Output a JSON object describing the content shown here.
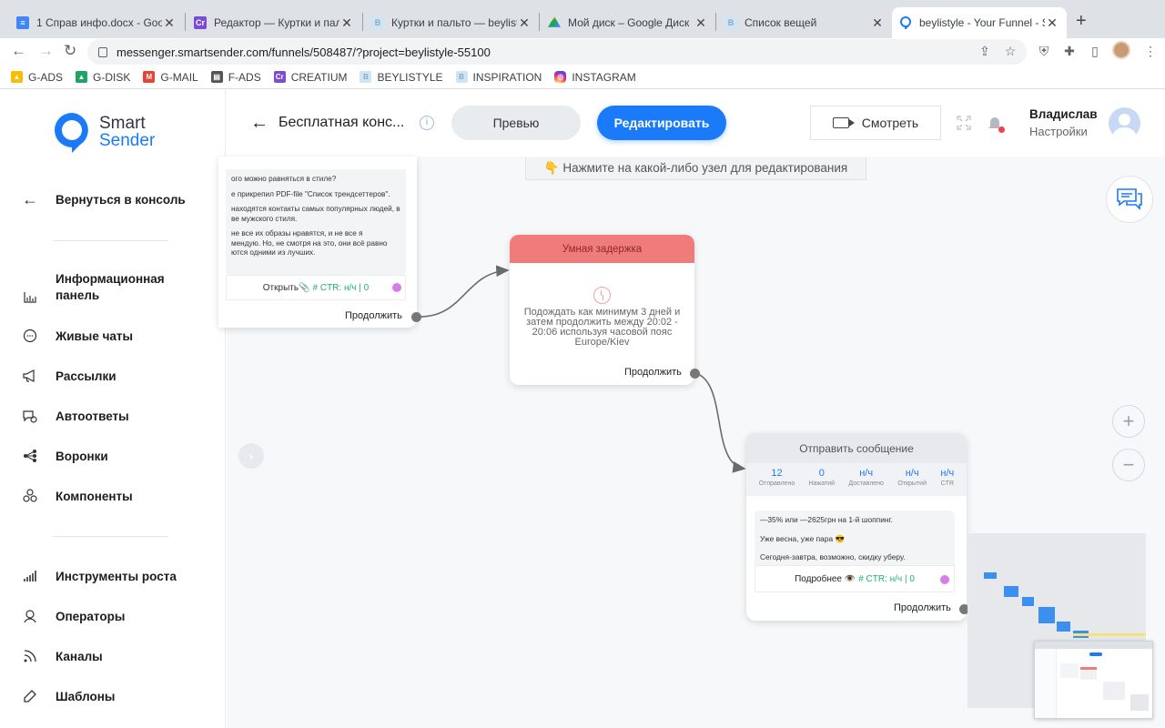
{
  "browser": {
    "tabs": [
      {
        "title": "1 Справ инфо.docx - Goog",
        "icon": "docs-icon",
        "color": "#4285f4"
      },
      {
        "title": "Редактор — Куртки и пальт",
        "icon": "creatium-icon",
        "color": "#7b4bd6"
      },
      {
        "title": "Куртки и пальто — beylistyl",
        "icon": "beylistyle-icon",
        "color": "#b9dcf2"
      },
      {
        "title": "Мой диск – Google Диск",
        "icon": "drive-icon",
        "color": "#1fa463"
      },
      {
        "title": "Список вещей",
        "icon": "beylistyle-icon",
        "color": "#b9dcf2"
      },
      {
        "title": "beylistyle - Your Funnel - S",
        "icon": "smartsender-icon",
        "color": "#1a7af8"
      }
    ],
    "url": "messenger.smartsender.com/funnels/508487/?project=beylistyle-55100",
    "bookmarks": [
      {
        "label": "G-ADS",
        "color": "#fbbc04"
      },
      {
        "label": "G-DISK",
        "color": "#1fa463"
      },
      {
        "label": "G-MAIL",
        "color": "#ea4335"
      },
      {
        "label": "F-ADS",
        "color": "#555555"
      },
      {
        "label": "CREATIUM",
        "color": "#7b4bd6"
      },
      {
        "label": "BEYLISTYLE",
        "color": "#b9dcf2"
      },
      {
        "label": "INSPIRATION",
        "color": "#b9dcf2"
      },
      {
        "label": "INSTAGRAM",
        "color": "#d62976"
      }
    ]
  },
  "sidebar": {
    "logo_top": "Smart",
    "logo_bottom": "Sender",
    "back": "Вернуться в консоль",
    "items": [
      {
        "label": "Информационная панель",
        "icon": "chart-bars-icon"
      },
      {
        "label": "Живые чаты",
        "icon": "chat-bubble-icon"
      },
      {
        "label": "Рассылки",
        "icon": "megaphone-icon"
      },
      {
        "label": "Автоответы",
        "icon": "autoreply-icon"
      },
      {
        "label": "Воронки",
        "icon": "funnel-share-icon"
      },
      {
        "label": "Компоненты",
        "icon": "components-icon"
      }
    ],
    "items2": [
      {
        "label": "Инструменты роста",
        "icon": "growth-bars-icon"
      },
      {
        "label": "Операторы",
        "icon": "operator-icon"
      },
      {
        "label": "Каналы",
        "icon": "channels-icon"
      },
      {
        "label": "Шаблоны",
        "icon": "templates-icon"
      }
    ]
  },
  "header": {
    "title": "Бесплатная конс...",
    "preview": "Превью",
    "edit": "Редактировать",
    "watch": "Смотреть",
    "user_name": "Владислав",
    "user_sub": "Настройки"
  },
  "canvas": {
    "hint": "👇 Нажмите на какой-либо узел для редактирования",
    "node1": {
      "lines": [
        "ого можно равняться в стиле?",
        "е прикрепил PDF-file \"Список трендсеттеров\".",
        "находятся контакты самых популярных людей, в\nве мужского стиля.",
        "не все их образы нравятся, и не все я\nмендую. Но, не смотря на это, они всё равно\nются одними из лучших."
      ],
      "button": "Открыть📎",
      "ctr": "# CTR: н/ч | 0",
      "continue": "Продолжить"
    },
    "node2": {
      "title": "Умная задержка",
      "text": "Подождать как минимум 3 дней и затем продолжить между 20:02 - 20:06 используя часовой пояс Europe/Kiev",
      "continue": "Продолжить"
    },
    "node3": {
      "title": "Отправить сообщение",
      "stats": [
        {
          "value": "12",
          "label": "Отправлено"
        },
        {
          "value": "0",
          "label": "Нажатий"
        },
        {
          "value": "н/ч",
          "label": "Доставлено"
        },
        {
          "value": "н/ч",
          "label": "Открытий"
        },
        {
          "value": "н/ч",
          "label": "CTR"
        }
      ],
      "lines": [
        "—35% или —2625грн на 1-й шоппинг.",
        "Уже весна, уже пара 😎",
        "Сегодня-завтра, возможно, скидку уберу."
      ],
      "button": "Подробнее 👁️",
      "ctr": "# CTR: н/ч | 0",
      "continue": "Продолжить"
    }
  }
}
